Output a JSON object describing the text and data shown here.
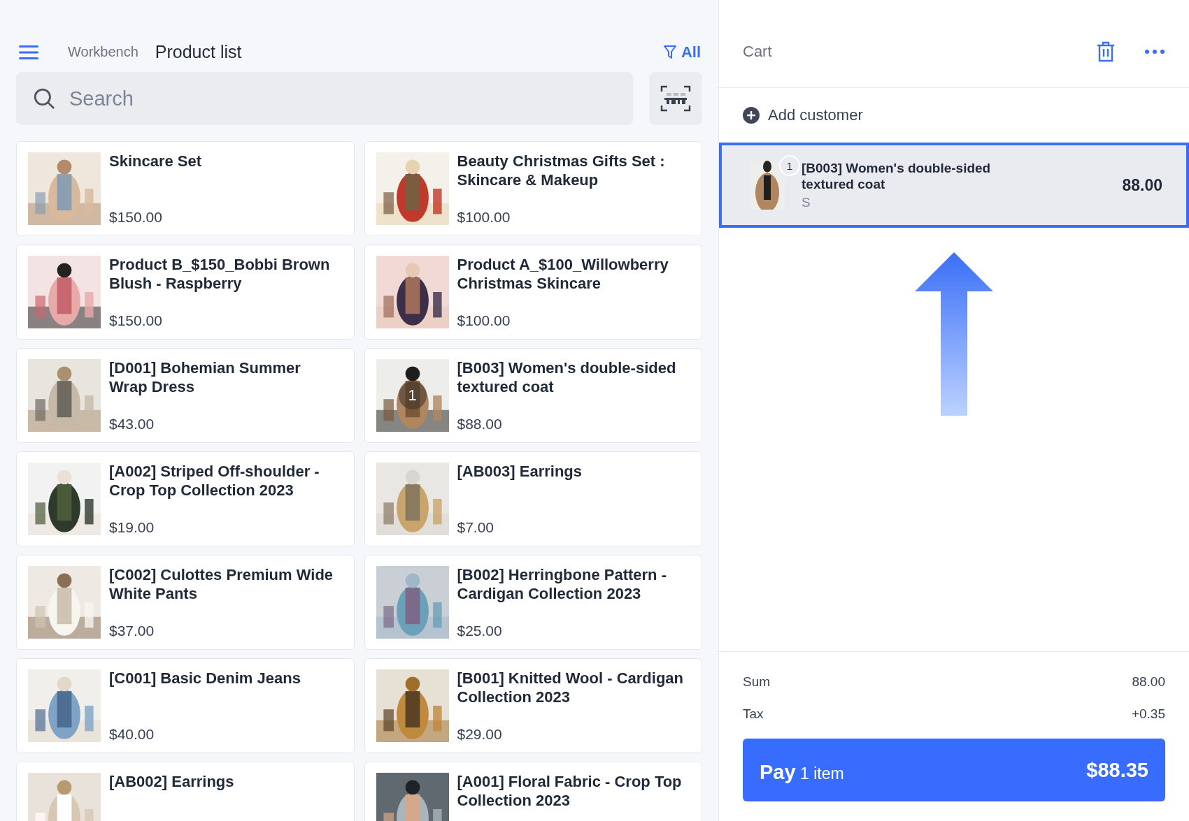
{
  "header": {
    "breadcrumb": "Workbench",
    "title": "Product list",
    "filter": "All"
  },
  "search": {
    "placeholder": "Search"
  },
  "products": [
    {
      "name": "Skincare Set",
      "price": "$150.00"
    },
    {
      "name": "Beauty Christmas Gifts Set : Skincare & Makeup",
      "price": "$100.00"
    },
    {
      "name": "Product B_$150_Bobbi Brown Blush - Raspberry",
      "price": "$150.00"
    },
    {
      "name": "Product A_$100_Willowberry Christmas Skincare",
      "price": "$100.00"
    },
    {
      "name": "[D001] Bohemian Summer Wrap Dress",
      "price": "$43.00"
    },
    {
      "name": "[B003] Women's double-sided textured coat",
      "price": "$88.00",
      "quantity": "1"
    },
    {
      "name": "[A002] Striped Off-shoulder - Crop Top Collection 2023",
      "price": "$19.00"
    },
    {
      "name": "[AB003] Earrings",
      "price": "$7.00"
    },
    {
      "name": "[C002] Culottes Premium Wide White Pants",
      "price": "$37.00"
    },
    {
      "name": "[B002] Herringbone Pattern - Cardigan Collection 2023",
      "price": "$25.00"
    },
    {
      "name": "[C001] Basic Denim Jeans",
      "price": "$40.00"
    },
    {
      "name": "[B001] Knitted Wool - Cardigan Collection 2023",
      "price": "$29.00"
    },
    {
      "name": "[AB002] Earrings"
    },
    {
      "name": "[A001] Floral Fabric - Crop Top Collection 2023"
    }
  ],
  "cart": {
    "title": "Cart",
    "add_customer": "Add customer",
    "items": [
      {
        "quantity": "1",
        "name": "[B003] Women's double-sided textured coat",
        "variant": "S",
        "price": "88.00",
        "selected": true
      }
    ],
    "summary": [
      {
        "label": "Sum",
        "value": "88.00"
      },
      {
        "label": "Tax",
        "value": "+0.35"
      }
    ],
    "pay": {
      "label": "Pay",
      "count": "1 item",
      "total": "$88.35"
    }
  }
}
